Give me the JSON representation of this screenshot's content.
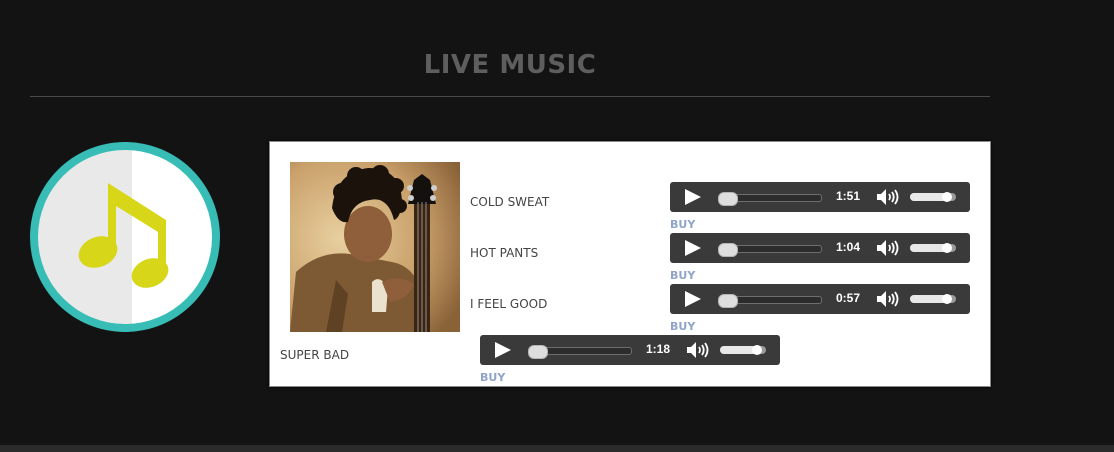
{
  "header": {
    "title": "LIVE MUSIC"
  },
  "badge": {
    "icon": "music-note-icon",
    "ring_color": "#37bdb5",
    "note_color": "#d8d619"
  },
  "album": {
    "image": "guitarist-photo"
  },
  "tracks": [
    {
      "title": "COLD SWEAT",
      "time": "1:51",
      "buy_label": "BUY",
      "progress": 0,
      "volume": 0.8
    },
    {
      "title": "HOT PANTS",
      "time": "1:04",
      "buy_label": "BUY",
      "progress": 0,
      "volume": 0.8
    },
    {
      "title": "I FEEL GOOD",
      "time": "0:57",
      "buy_label": "BUY",
      "progress": 0,
      "volume": 0.8
    },
    {
      "title": "SUPER BAD",
      "time": "1:18",
      "buy_label": "BUY",
      "progress": 0,
      "volume": 0.8
    }
  ],
  "colors": {
    "background": "#131313",
    "player": "#3a3a3a",
    "buy": "#8fa4c8"
  }
}
